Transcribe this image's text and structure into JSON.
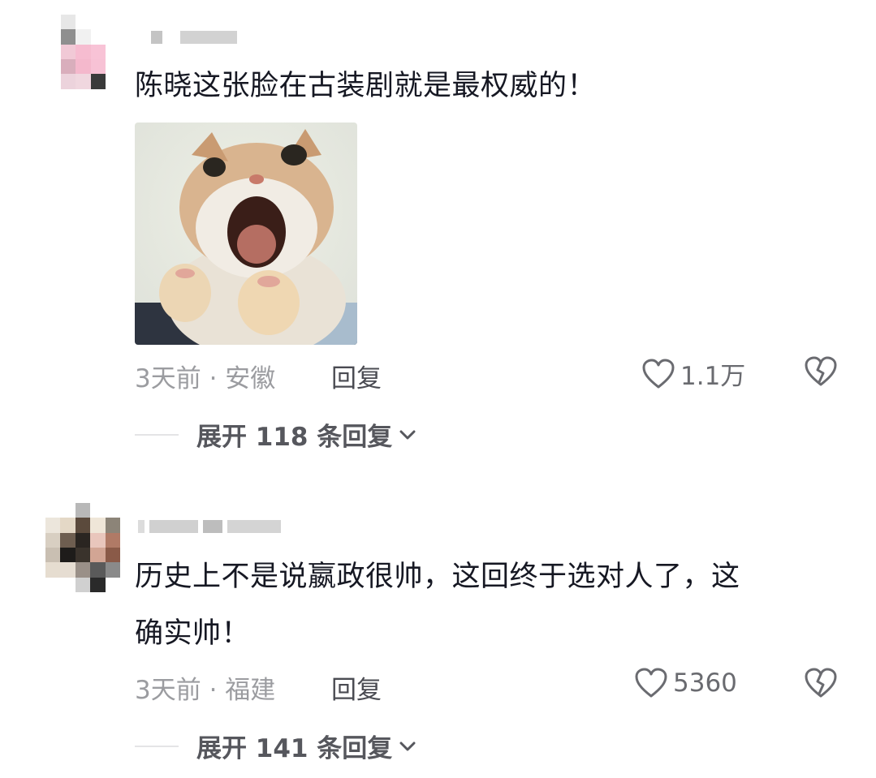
{
  "comments": [
    {
      "text_lines": [
        "陈晓这张脸在古装剧就是最权威的！"
      ],
      "meta": "3天前 · 安徽",
      "reply_label": "回复",
      "likes": "1.1万",
      "expand_label": "展开 118 条回复"
    },
    {
      "text_lines": [
        "历史上不是说嬴政很帅，这回终于选对人了，这",
        "确实帅！"
      ],
      "meta": "3天前 · 福建",
      "reply_label": "回复",
      "likes": "5360",
      "expand_label": "展开 141 条回复"
    }
  ],
  "icons": {
    "like": "heart-outline-icon",
    "dislike": "broken-heart-icon",
    "expand": "chevron-down-icon"
  },
  "colors": {
    "text": "#161823",
    "meta": "#9b9ca0",
    "action": "#56575d"
  }
}
